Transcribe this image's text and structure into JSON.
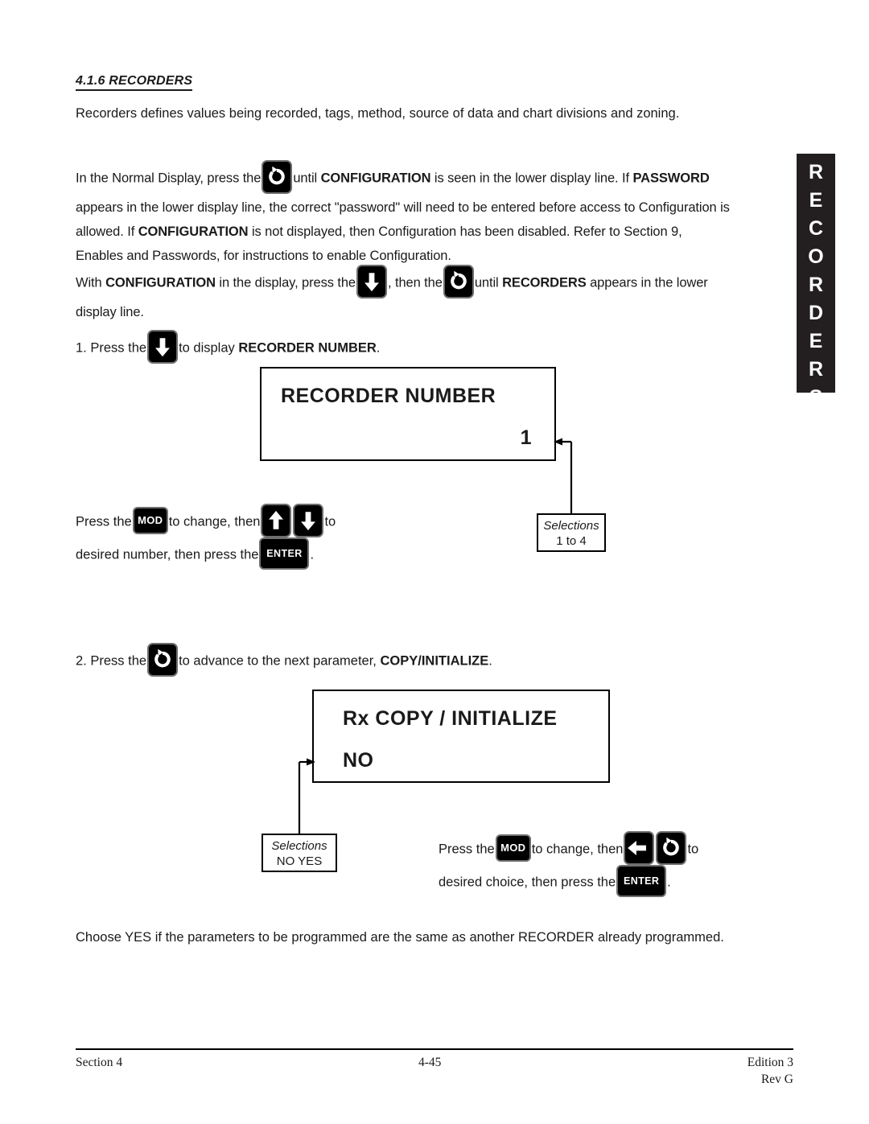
{
  "section": {
    "number": "4.1.6",
    "title": "RECORDERS",
    "heading": "4.1.6  RECORDERS",
    "intro": "Recorders defines values being recorded, tags, method, source of data and chart divisions and zoning."
  },
  "edge_tab": {
    "label": "RECORDERS",
    "letters": [
      "R",
      "E",
      "C",
      "O",
      "R",
      "D",
      "E",
      "R",
      "S"
    ],
    "background": "#231f20",
    "color": "#ffffff"
  },
  "paragraphs": {
    "normal_display": {
      "p1": "In the Normal Display, press the",
      "p2": "until",
      "bold1": "CONFIGURATION",
      "p3": "is seen in the lower display line.  If",
      "bold2": "PASSWORD",
      "line2": "appears in the lower display line, the correct \"password\" will need to be entered before access to Configuration is",
      "line3_a": "allowed.  If",
      "bold3": "CONFIGURATION",
      "line3_b": "is not displayed, then Configuration has been disabled.  Refer to Section 9,",
      "line4": "Enables and Passwords, for instructions to enable Configuration."
    },
    "with_configuration": {
      "a": "With",
      "bold1": "CONFIGURATION",
      "b": "in the display, press the",
      "c": ", then the",
      "d": "until",
      "bold2": "RECORDERS",
      "e": "appears in the lower",
      "line2": "display line."
    },
    "closing": "Choose YES if the parameters to be programmed are the same as another RECORDER already programmed."
  },
  "steps": [
    {
      "number": "1.",
      "text_a": "Press the",
      "text_b": "to display",
      "bold": "RECORDER NUMBER",
      "text_c": ".",
      "key": "down-arrow-key"
    },
    {
      "number": "2.",
      "text_a": "Press the",
      "text_b": "to advance to the next parameter,",
      "bold": "COPY/INITIALIZE",
      "text_c": ".",
      "key": "function-loop-key"
    }
  ],
  "displays": [
    {
      "name": "recorder-number-display",
      "line1": "RECORDER  NUMBER",
      "line2": "1",
      "line2_align": "right"
    },
    {
      "name": "copy-initialize-display",
      "line1": "Rx  COPY / INITIALIZE",
      "line2": "NO",
      "line2_align": "left"
    }
  ],
  "callouts": [
    {
      "name": "selections-recorder-number",
      "caption": "Selections",
      "values": "1 to 4"
    },
    {
      "name": "selections-copy-initialize",
      "caption": "Selections",
      "values": "NO   YES"
    }
  ],
  "key_instructions": [
    {
      "name": "recorder-number-key-instruction",
      "a": "Press  the",
      "b": "to change, then",
      "c": "to",
      "d": "desired number, then press the",
      "e": ".",
      "mod_label": "MOD",
      "enter_label": "ENTER",
      "keys": [
        "up-arrow-key",
        "down-arrow-key"
      ]
    },
    {
      "name": "copy-initialize-key-instruction",
      "a": "Press  the",
      "b": "to change, then",
      "c": "to",
      "d": "desired choice, then press the",
      "e": ".",
      "mod_label": "MOD",
      "enter_label": "ENTER",
      "keys": [
        "left-arrow-key",
        "function-loop-key"
      ]
    }
  ],
  "footer": {
    "left": "Section 4",
    "center": "4-45",
    "right_line1": "Edition 3",
    "right_line2": "Rev G"
  }
}
